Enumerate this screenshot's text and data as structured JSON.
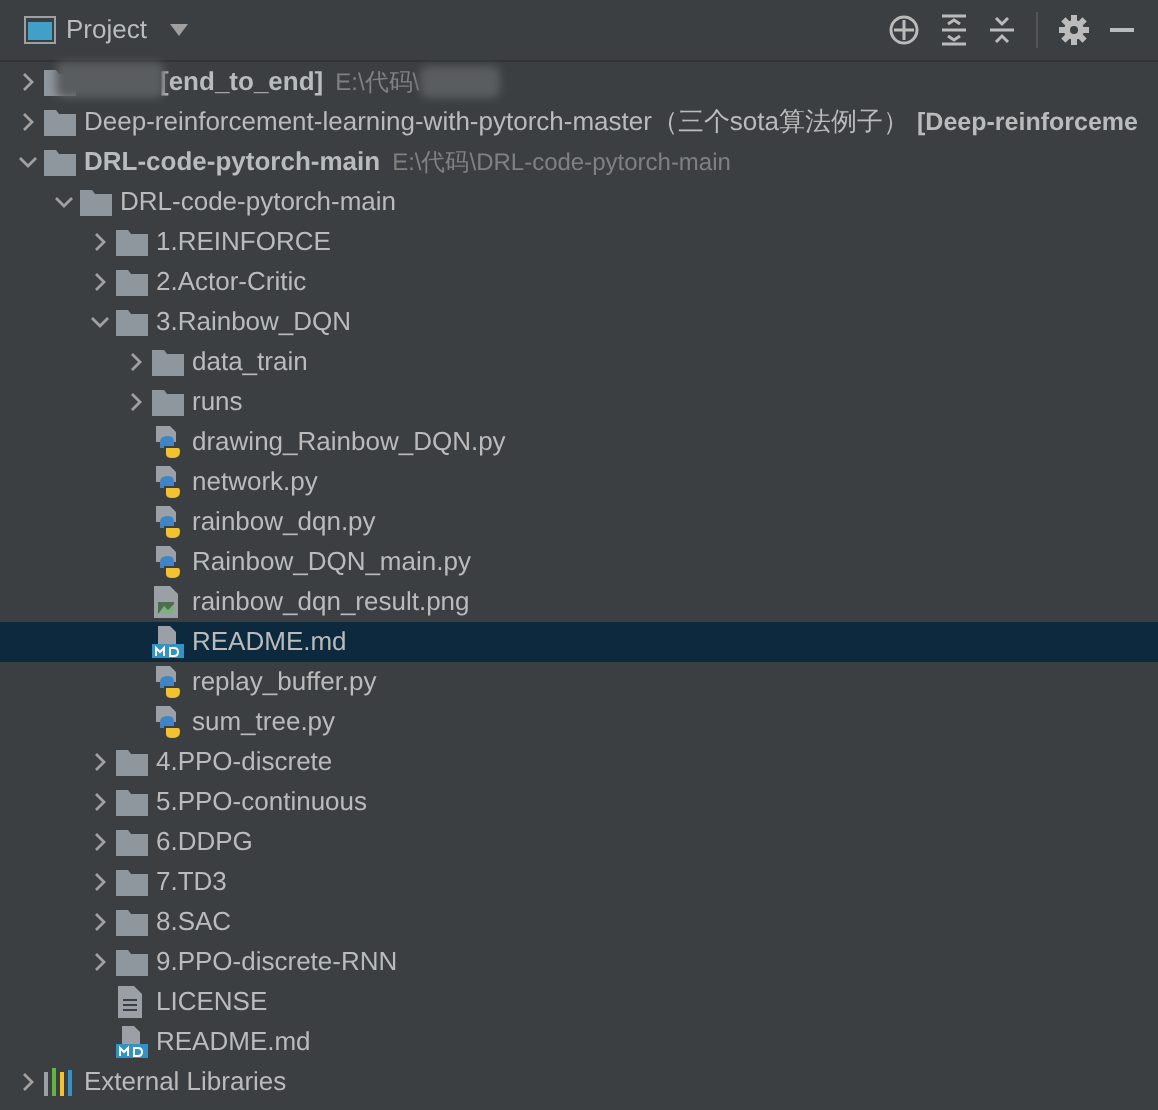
{
  "panel": {
    "title": "Project"
  },
  "tree": [
    {
      "kind": "folder",
      "label": "[end_to_end]",
      "bold": true,
      "path": "E:\\代码\\",
      "redacted": true,
      "expanded": false,
      "selected": false
    },
    {
      "kind": "folder",
      "label": "Deep-reinforcement-learning-with-pytorch-master（三个sota算法例子）",
      "module": "[Deep-reinforceme",
      "expanded": false,
      "selected": false
    },
    {
      "kind": "folder",
      "label": "DRL-code-pytorch-main",
      "bold": true,
      "path": "E:\\代码\\DRL-code-pytorch-main",
      "expanded": true,
      "selected": false,
      "children": [
        {
          "kind": "folder",
          "label": "DRL-code-pytorch-main",
          "expanded": true,
          "selected": false,
          "children": [
            {
              "kind": "folder",
              "label": "1.REINFORCE",
              "expanded": false,
              "selected": false
            },
            {
              "kind": "folder",
              "label": "2.Actor-Critic",
              "expanded": false,
              "selected": false
            },
            {
              "kind": "folder",
              "label": "3.Rainbow_DQN",
              "expanded": true,
              "selected": false,
              "children": [
                {
                  "kind": "folder",
                  "label": "data_train",
                  "expanded": false,
                  "selected": false
                },
                {
                  "kind": "folder",
                  "label": "runs",
                  "expanded": false,
                  "selected": false
                },
                {
                  "kind": "python",
                  "label": "drawing_Rainbow_DQN.py",
                  "selected": false
                },
                {
                  "kind": "python",
                  "label": "network.py",
                  "selected": false
                },
                {
                  "kind": "python",
                  "label": "rainbow_dqn.py",
                  "selected": false
                },
                {
                  "kind": "python",
                  "label": "Rainbow_DQN_main.py",
                  "selected": false
                },
                {
                  "kind": "image",
                  "label": "rainbow_dqn_result.png",
                  "selected": false
                },
                {
                  "kind": "markdown",
                  "label": "README.md",
                  "selected": true
                },
                {
                  "kind": "python",
                  "label": "replay_buffer.py",
                  "selected": false
                },
                {
                  "kind": "python",
                  "label": "sum_tree.py",
                  "selected": false
                }
              ]
            },
            {
              "kind": "folder",
              "label": "4.PPO-discrete",
              "expanded": false,
              "selected": false
            },
            {
              "kind": "folder",
              "label": "5.PPO-continuous",
              "expanded": false,
              "selected": false
            },
            {
              "kind": "folder",
              "label": "6.DDPG",
              "expanded": false,
              "selected": false
            },
            {
              "kind": "folder",
              "label": "7.TD3",
              "expanded": false,
              "selected": false
            },
            {
              "kind": "folder",
              "label": "8.SAC",
              "expanded": false,
              "selected": false
            },
            {
              "kind": "folder",
              "label": "9.PPO-discrete-RNN",
              "expanded": false,
              "selected": false
            },
            {
              "kind": "text",
              "label": "LICENSE",
              "selected": false
            },
            {
              "kind": "markdown",
              "label": "README.md",
              "selected": false
            }
          ]
        }
      ]
    },
    {
      "kind": "library",
      "label": "External Libraries",
      "expanded": false,
      "selected": false
    }
  ]
}
